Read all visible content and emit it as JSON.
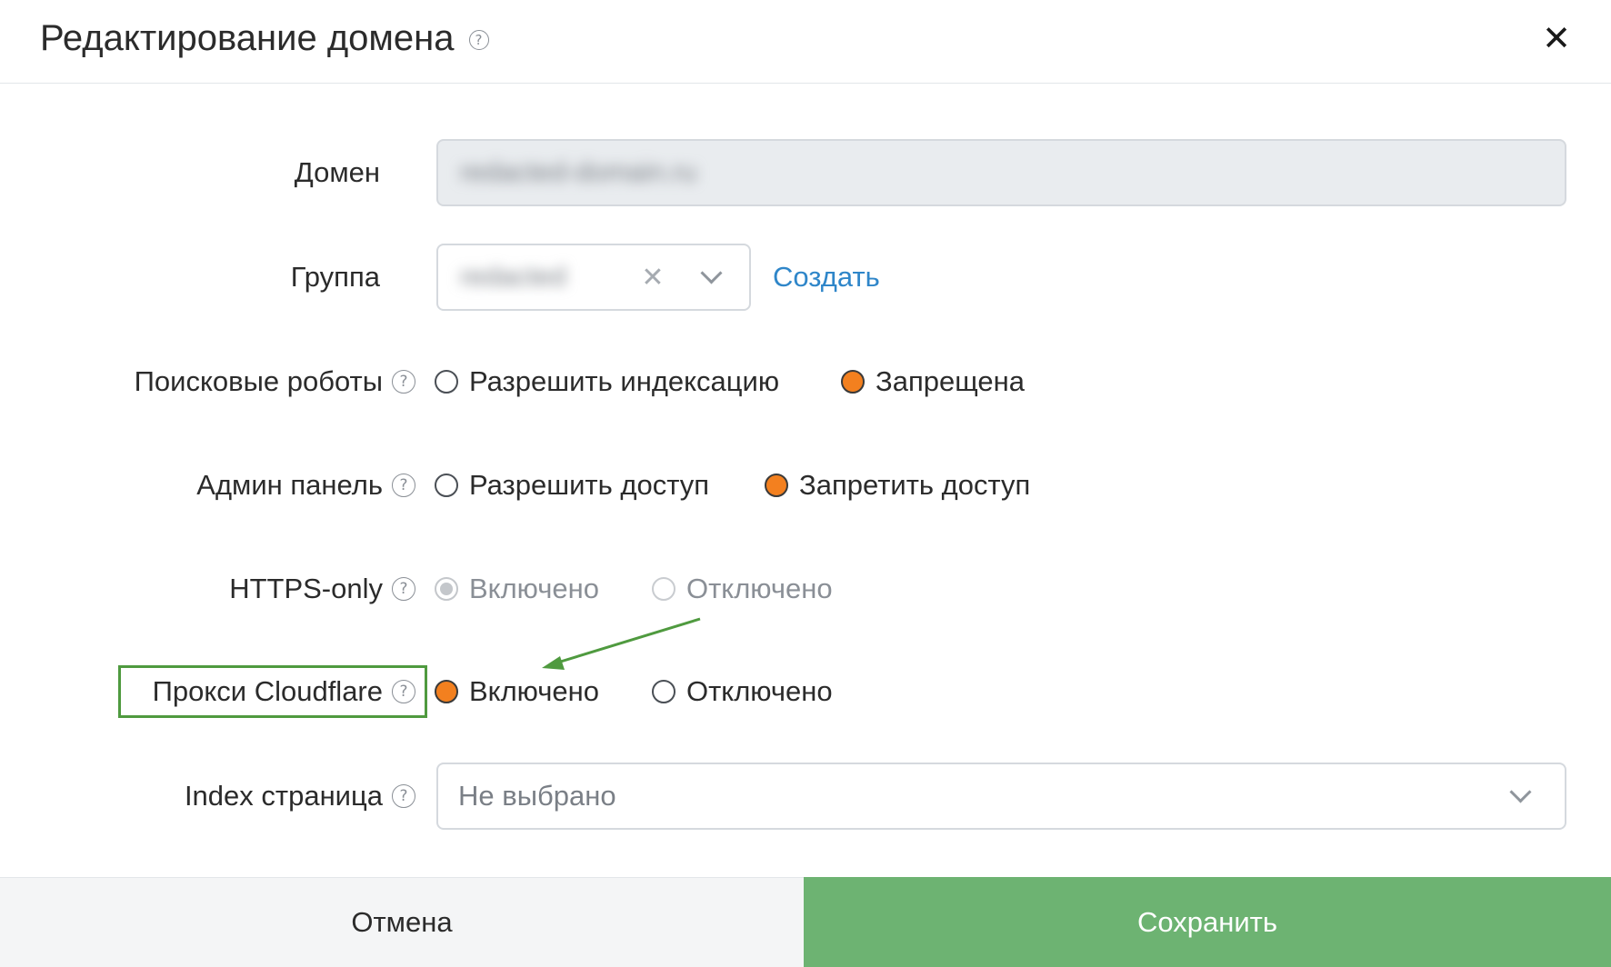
{
  "dialog": {
    "title": "Редактирование домена",
    "help_glyph": "?",
    "close_glyph": "✕"
  },
  "form": {
    "domain": {
      "label": "Домен",
      "value": "redacted-domain.ru"
    },
    "group": {
      "label": "Группа",
      "value": "redacted",
      "clear_glyph": "✕",
      "create_link": "Создать"
    },
    "search_robots": {
      "label": "Поисковые роботы",
      "options": [
        "Разрешить индексацию",
        "Запрещена"
      ],
      "selected": "Запрещена"
    },
    "admin_panel": {
      "label": "Админ панель",
      "options": [
        "Разрешить доступ",
        "Запретить доступ"
      ],
      "selected": "Запретить доступ"
    },
    "https_only": {
      "label": "HTTPS-only",
      "options": [
        "Включено",
        "Отключено"
      ],
      "selected": "Включено",
      "disabled": true
    },
    "cloudflare_proxy": {
      "label": "Прокси Cloudflare",
      "options": [
        "Включено",
        "Отключено"
      ],
      "selected": "Включено",
      "highlighted": true
    },
    "index_page": {
      "label": "Index страница",
      "placeholder": "Не выбрано"
    }
  },
  "footer": {
    "cancel_label": "Отмена",
    "save_label": "Сохранить"
  },
  "colors": {
    "accent_radio": "#f3801f",
    "save_button": "#6db372",
    "link": "#2f86c9",
    "highlight": "#4f9a3f"
  }
}
